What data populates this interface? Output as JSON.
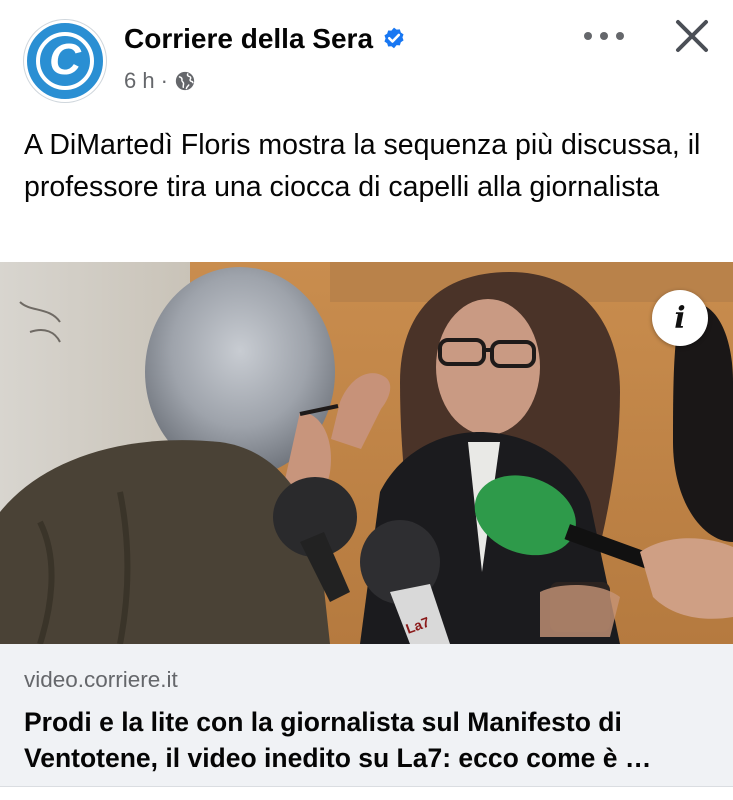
{
  "post": {
    "page_name": "Corriere della Sera",
    "avatar_letter": "C",
    "time": "6 h",
    "separator": "·",
    "audience_icon": "globe-icon",
    "verified_icon": "verified-badge-icon",
    "more_icon": "more-options-icon",
    "close_icon": "close-icon",
    "text": "A DiMartedì Floris mostra la sequenza più discussa, il professore tira una ciocca di capelli alla giornalista"
  },
  "media": {
    "info_icon": "info-icon",
    "info_glyph": "i",
    "mic_logo_text": "La7"
  },
  "link": {
    "domain": "video.corriere.it",
    "title": "Prodi e la lite con la giornalista sul Manifesto di Ventotene, il video inedito su La7: ecco come è …"
  },
  "colors": {
    "brand_blue": "#2a8fd3",
    "verified_blue": "#1877f2",
    "secondary_text": "#65676b",
    "link_card_bg": "#f0f2f5"
  }
}
